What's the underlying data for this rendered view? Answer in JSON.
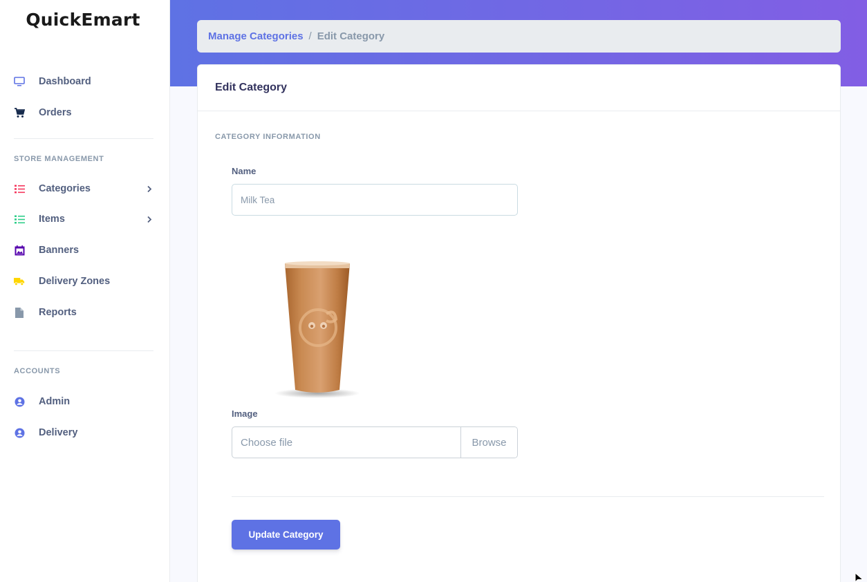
{
  "brand": "QuickEmart",
  "sidebar": {
    "items": [
      {
        "label": "Dashboard",
        "icon": "monitor-icon",
        "color": "#5e72e4"
      },
      {
        "label": "Orders",
        "icon": "cart-icon",
        "color": "#172b4d"
      }
    ],
    "store_heading": "STORE MANAGEMENT",
    "store_items": [
      {
        "label": "Categories",
        "icon": "list-icon",
        "color": "#f5365c"
      },
      {
        "label": "Items",
        "icon": "list-icon",
        "color": "#2dce89"
      },
      {
        "label": "Banners",
        "icon": "image-icon",
        "color": "#5603ad"
      },
      {
        "label": "Delivery Zones",
        "icon": "truck-icon",
        "color": "#ffd600"
      },
      {
        "label": "Reports",
        "icon": "file-icon",
        "color": "#8898aa"
      }
    ],
    "accounts_heading": "ACCOUNTS",
    "account_items": [
      {
        "label": "Admin",
        "icon": "user-circle-icon",
        "color": "#5e72e4"
      },
      {
        "label": "Delivery",
        "icon": "user-circle-icon",
        "color": "#5e72e4"
      }
    ]
  },
  "breadcrumb": {
    "parent": "Manage Categories",
    "separator": "/",
    "current": "Edit Category"
  },
  "card": {
    "title": "Edit Category",
    "section_heading": "CATEGORY INFORMATION",
    "name_label": "Name",
    "name_value": "Milk Tea",
    "image_label": "Image",
    "file_placeholder": "Choose file",
    "browse_label": "Browse",
    "submit_label": "Update Category"
  },
  "colors": {
    "accent": "#5e72e4",
    "gradient_start": "#5e72e4",
    "gradient_end": "#825ee4"
  }
}
